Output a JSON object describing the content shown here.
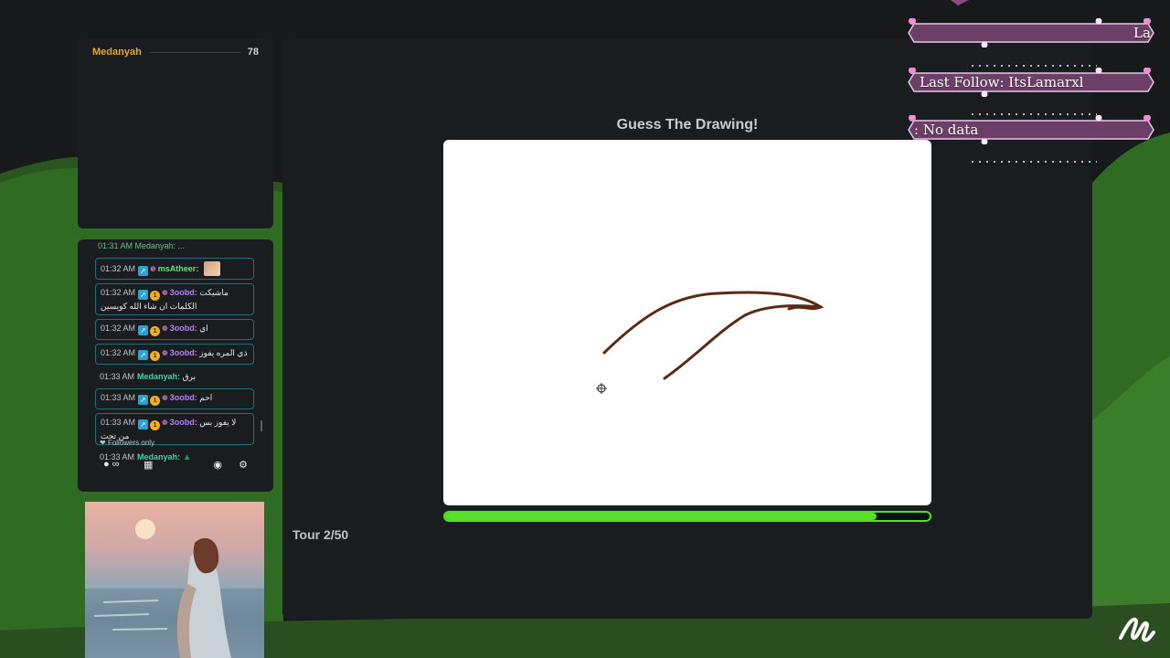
{
  "leaderboard": {
    "name": "Medanyah",
    "score": "78"
  },
  "chat": {
    "top_cut": "01:31 AM Medanyah: ...",
    "messages": [
      {
        "time": "01:32 AM",
        "user": "msAtheer:",
        "text": "",
        "boxed": true,
        "color": "green",
        "badges": true,
        "avatar": true
      },
      {
        "time": "01:32 AM",
        "user": "3oobd:",
        "text": "ماشيكت الكلمات ان شاء الله كويسين",
        "boxed": true,
        "color": "purple",
        "badges": true
      },
      {
        "time": "01:32 AM",
        "user": "3oobd:",
        "text": "اي",
        "boxed": true,
        "color": "purple",
        "badges": true
      },
      {
        "time": "01:32 AM",
        "user": "3oobd:",
        "text": "ذي المره يفوز",
        "boxed": true,
        "color": "purple",
        "badges": true
      },
      {
        "time": "01:33 AM",
        "user": "Medanyah:",
        "text": "برق",
        "boxed": false,
        "color": "teal",
        "badges": false
      },
      {
        "time": "01:33 AM",
        "user": "3oobd:",
        "text": "احم",
        "boxed": true,
        "color": "purple",
        "badges": true
      },
      {
        "time": "01:33 AM",
        "user": "3oobd:",
        "text": "لا يفوز بس من تحت",
        "boxed": true,
        "color": "purple",
        "badges": true
      },
      {
        "time": "01:33 AM",
        "user": "Medanyah:",
        "text": "",
        "boxed": false,
        "color": "teal",
        "badges": false,
        "emoji": true
      }
    ],
    "followers_only": "Followers only",
    "toolbar": {
      "points_label": "∞"
    }
  },
  "game": {
    "title": "Guess The Drawing!",
    "round": "Tour 2/50",
    "progress_pct": 89
  },
  "banners": {
    "b1": "La",
    "b2": "Last Follow: ItsLamarxl",
    "b3": ": No data"
  },
  "colors": {
    "accent_green": "#56de2a",
    "stroke_brown": "#5a2a14",
    "banner_purple": "#6b3f66"
  },
  "icons": [
    "heart-icon",
    "points-icon",
    "store-icon",
    "chat-icon",
    "gear-icon",
    "crosshair-icon",
    "brush-logo-icon"
  ]
}
